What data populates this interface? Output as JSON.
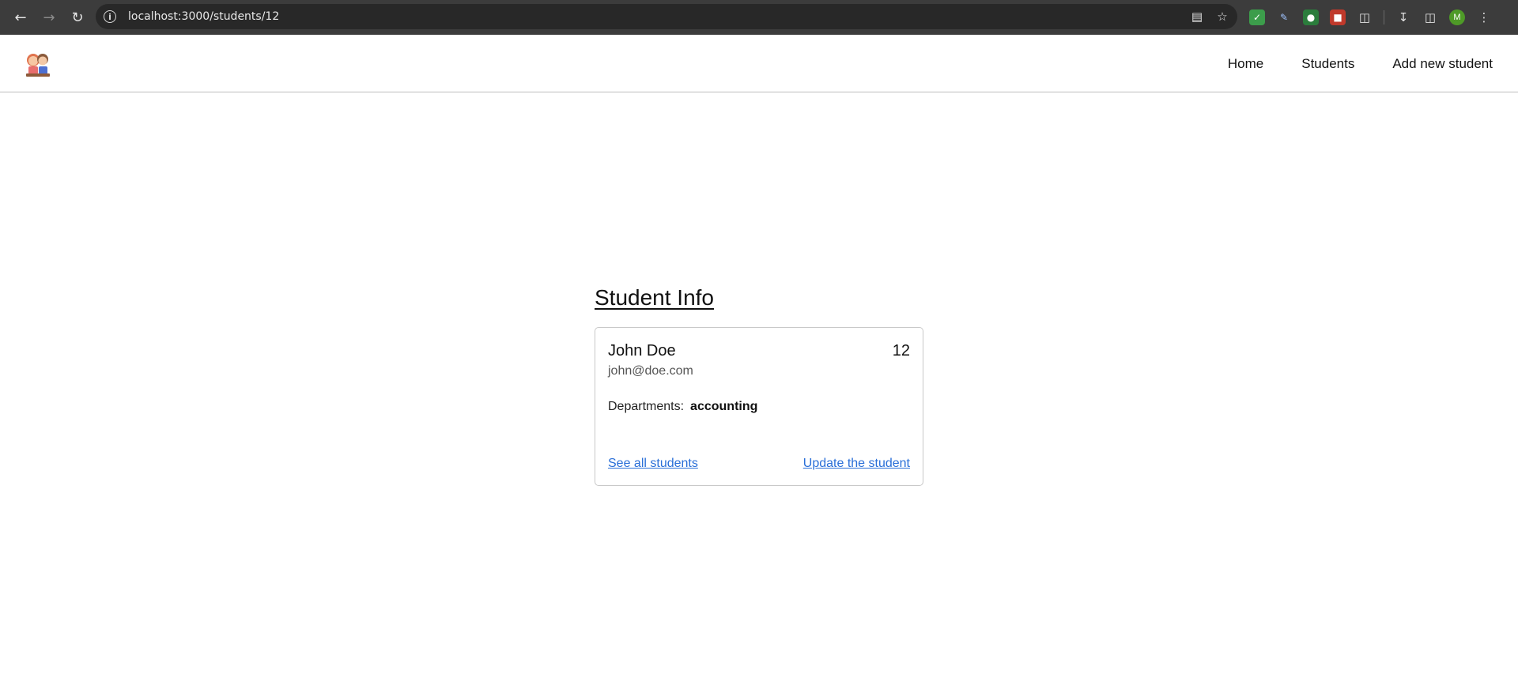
{
  "browser": {
    "url": "localhost:3000/students/12",
    "back_icon": "arrow-left-icon",
    "forward_icon": "arrow-right-icon",
    "reload_icon": "reload-icon",
    "avatar_initial": "M"
  },
  "navbar": {
    "links": [
      "Home",
      "Students",
      "Add new student"
    ]
  },
  "page": {
    "title": "Student Info"
  },
  "student": {
    "name": "John Doe",
    "id": "12",
    "email": "john@doe.com",
    "departments_label": "Departments:",
    "departments_value": "accounting",
    "see_all_label": "See all students",
    "update_label": "Update the student"
  },
  "colors": {
    "link": "#2a6fd8",
    "chrome_bg": "#3c3c3c"
  }
}
